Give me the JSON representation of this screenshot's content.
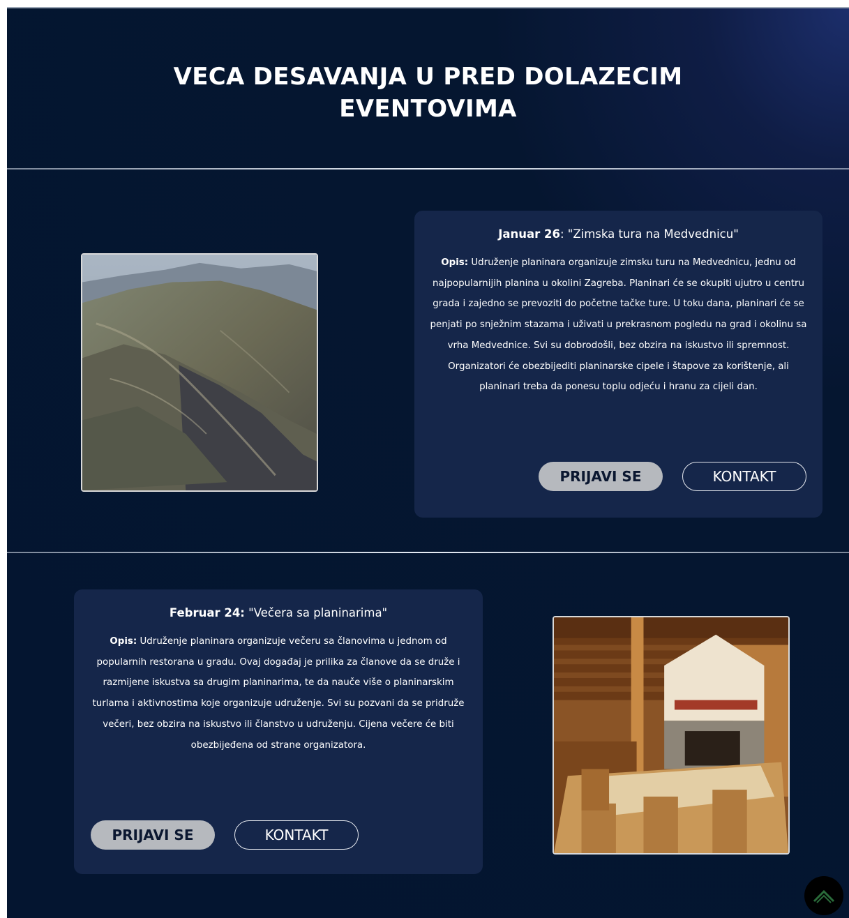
{
  "section": {
    "heading_line1": "VECA DESAVANJA U PRED DOLAZECIM",
    "heading_line2": "EVENTOVIMA"
  },
  "events": [
    {
      "date": "Januar 26",
      "title": ": \"Zimska tura na Medvednicu\"",
      "desc_label": "Opis:",
      "description": " Udruženje planinara organizuje zimsku turu na Medvednicu, jednu od najpopularnijih planina u okolini Zagreba. Planinari će se okupiti ujutro u centru grada i zajedno se prevoziti do početne tačke ture. U toku dana, planinari će se penjati po snježnim stazama i uživati u prekrasnom pogledu na grad i okolinu sa vrha Medvednice. Svi su dobrodošli, bez obzira na iskustvo ili spremnost. Organizatori će obezbijediti planinarske cipele i štapove za korištenje, ali planinari treba da ponesu toplu odjeću i hranu za cijeli dan.",
      "register_label": "PRIJAVI SE",
      "contact_label": "KONTAKT",
      "image": "mountain-ridge-photo"
    },
    {
      "date": "Februar 24:",
      "title": " \"Večera sa planinarima\"",
      "desc_label": "Opis:",
      "description": " Udruženje planinara organizuje večeru sa članovima u jednom od popularnih restorana u gradu. Ovaj događaj je prilika za članove da se druže i razmijene iskustva sa drugim planinarima, te da nauče više o planinarskim turlama i aktivnostima koje organizuje udruženje. Svi su pozvani da se pridruže večeri, bez obzira na iskustvo ili članstvo u udruženju. Cijena večere će biti obezbijeđena od strane organizatora.",
      "register_label": "PRIJAVI SE",
      "contact_label": "KONTAKT",
      "image": "wooden-restaurant-interior-photo"
    }
  ],
  "scroll_top": {
    "icon": "chevron-up-icon"
  },
  "colors": {
    "background": "#041530",
    "card": "#15264a",
    "primary_button": "#b6b9be",
    "text": "#ffffff"
  }
}
